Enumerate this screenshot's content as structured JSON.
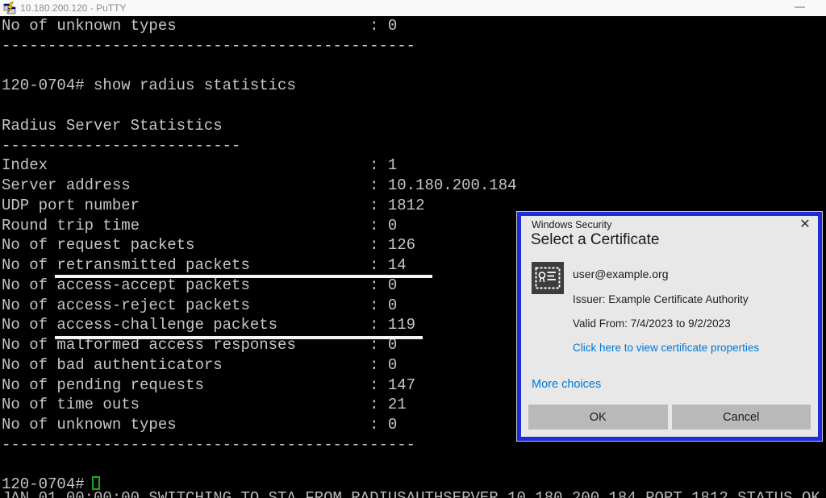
{
  "window": {
    "title": "10.180.200.120 - PuTTY"
  },
  "terminal": {
    "lines": [
      "No of unknown types                     : 0",
      "---------------------------------------------",
      "",
      "120-0704# show radius statistics",
      "",
      "Radius Server Statistics",
      "--------------------------",
      "Index                                   : 1",
      "Server address                          : 10.180.200.184",
      "UDP port number                         : 1812",
      "Round trip time                         : 0",
      "No of request packets                   : 126",
      "No of retransmitted packets             : 14",
      "No of access-accept packets             : 0",
      "No of access-reject packets             : 0",
      "No of access-challenge packets          : 119",
      "No of malformed access responses        : 0",
      "No of bad authenticators                : 0",
      "No of pending requests                  : 147",
      "No of time outs                         : 21",
      "No of unknown types                     : 0",
      "---------------------------------------------",
      "",
      "120-0704# "
    ],
    "clipped_bottom_line": "JAN 01 00:00:00 SWITCHING TO STA FROM RADIUSAUTHSERVER 10.180.200.184 PORT 1812 STATUS OK"
  },
  "dialog": {
    "header": "Windows Security",
    "title": "Select a Certificate",
    "close_glyph": "✕",
    "certificate": {
      "subject": "user@example.org",
      "issuer": "Issuer: Example Certificate Authority",
      "validity": "Valid From: 7/4/2023 to 9/2/2023",
      "properties_link": "Click here to view certificate properties"
    },
    "more_choices_link": "More choices",
    "ok_label": "OK",
    "cancel_label": "Cancel"
  },
  "colors": {
    "dialog_border": "#1e2bd8",
    "link": "#0078d7",
    "terminal_fg": "#c6c6c6",
    "cursor_green": "#14ae14",
    "button_gray": "#b9b9b9"
  }
}
